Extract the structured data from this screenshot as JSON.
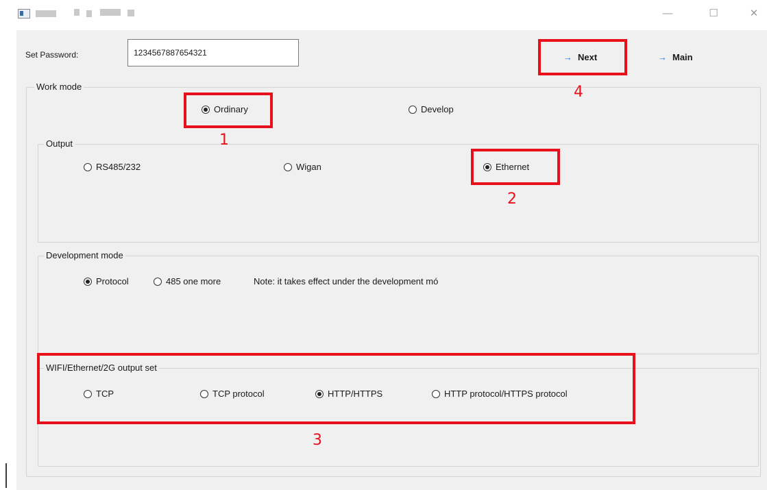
{
  "window": {
    "title_obscured": true,
    "controls": {
      "minimize": "—",
      "maximize": "☐",
      "close": "✕"
    }
  },
  "password": {
    "label": "Set Password:",
    "value": "1234567887654321"
  },
  "nav": {
    "next_label": "Next",
    "main_label": "Main",
    "arrow": "→"
  },
  "work_mode": {
    "title": "Work mode",
    "options": [
      {
        "label": "Ordinary",
        "selected": true
      },
      {
        "label": "Develop",
        "selected": false
      }
    ]
  },
  "output": {
    "title": "Output",
    "options": [
      {
        "label": "RS485/232",
        "selected": false
      },
      {
        "label": "Wigan",
        "selected": false
      },
      {
        "label": "Ethernet",
        "selected": true
      }
    ]
  },
  "development_mode": {
    "title": "Development mode",
    "options": [
      {
        "label": "Protocol",
        "selected": true
      },
      {
        "label": "485 one more",
        "selected": false
      }
    ],
    "note": "Note: it takes effect under the development mó"
  },
  "wifi_output": {
    "title": "WIFI/Ethernet/2G output set",
    "options": [
      {
        "label": "TCP",
        "selected": false
      },
      {
        "label": "TCP protocol",
        "selected": false
      },
      {
        "label": "HTTP/HTTPS",
        "selected": true
      },
      {
        "label": "HTTP protocol/HTTPS protocol",
        "selected": false
      }
    ]
  },
  "annotations": {
    "color": "#e8101a",
    "labels": [
      "1",
      "2",
      "3",
      "4"
    ]
  }
}
